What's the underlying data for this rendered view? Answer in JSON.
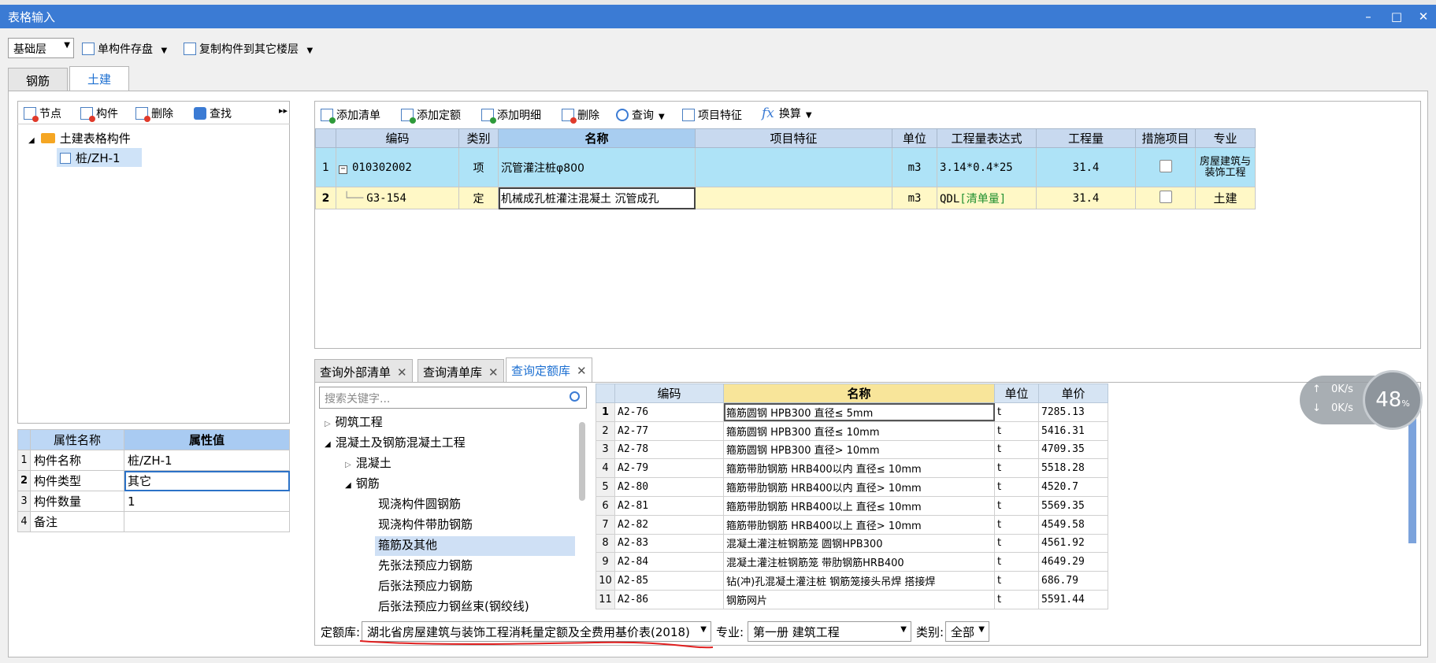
{
  "window": {
    "title": "表格输入"
  },
  "toolbar": {
    "floor_select": "基础层",
    "save_component": "单构件存盘",
    "copy_to_floor": "复制构件到其它楼层"
  },
  "main_tabs": [
    "钢筋",
    "土建"
  ],
  "left_toolbar": {
    "node": "节点",
    "component": "构件",
    "delete": "删除",
    "find": "查找"
  },
  "tree": {
    "root": "土建表格构件",
    "child": "桩/ZH-1"
  },
  "props": {
    "headers": [
      "属性名称",
      "属性值"
    ],
    "rows": [
      {
        "n": "1",
        "name": "构件名称",
        "value": "桩/ZH-1"
      },
      {
        "n": "2",
        "name": "构件类型",
        "value": "其它"
      },
      {
        "n": "3",
        "name": "构件数量",
        "value": "1"
      },
      {
        "n": "4",
        "name": "备注",
        "value": ""
      }
    ]
  },
  "grid_toolbar": {
    "add_list": "添加清单",
    "add_quota": "添加定额",
    "add_detail": "添加明细",
    "delete": "删除",
    "query": "查询",
    "feature": "项目特征",
    "convert": "换算"
  },
  "bill": {
    "headers": [
      "编码",
      "类别",
      "名称",
      "项目特征",
      "单位",
      "工程量表达式",
      "工程量",
      "措施项目",
      "专业"
    ],
    "rows": [
      {
        "n": "1",
        "code": "010302002",
        "type": "项",
        "name": "沉管灌注桩φ800",
        "feature": "",
        "unit": "m3",
        "expr": "3.14*0.4*25",
        "qty": "31.4",
        "major": "房屋建筑与装饰工程"
      },
      {
        "n": "2",
        "code": "G3-154",
        "type": "定",
        "name": "机械成孔桩灌注混凝土 沉管成孔",
        "feature": "",
        "unit": "m3",
        "expr_prefix": "QDL",
        "expr_tag": "[清单量]",
        "qty": "31.4",
        "major": "土建"
      }
    ]
  },
  "bottom_tabs": [
    "查询外部清单",
    "查询清单库",
    "查询定额库"
  ],
  "search": {
    "placeholder": "搜索关键字..."
  },
  "lib_tree": {
    "masonry": "砌筑工程",
    "concrete": "混凝土及钢筋混凝土工程",
    "concrete_sub": "混凝土",
    "rebar": "钢筋",
    "leaf1": "现浇构件圆钢筋",
    "leaf2": "现浇构件带肋钢筋",
    "leaf3": "箍筋及其他",
    "leaf4": "先张法预应力钢筋",
    "leaf5": "后张法预应力钢筋",
    "leaf6": "后张法预应力钢丝束(钢绞线)"
  },
  "quota": {
    "headers": [
      "编码",
      "名称",
      "单位",
      "单价"
    ],
    "rows": [
      {
        "n": "1",
        "code": "A2-76",
        "name": "箍筋圆钢 HPB300 直径≤ 5mm",
        "unit": "t",
        "price": "7285.13"
      },
      {
        "n": "2",
        "code": "A2-77",
        "name": "箍筋圆钢 HPB300 直径≤ 10mm",
        "unit": "t",
        "price": "5416.31"
      },
      {
        "n": "3",
        "code": "A2-78",
        "name": "箍筋圆钢 HPB300 直径> 10mm",
        "unit": "t",
        "price": "4709.35"
      },
      {
        "n": "4",
        "code": "A2-79",
        "name": "箍筋带肋钢筋 HRB400以内 直径≤ 10mm",
        "unit": "t",
        "price": "5518.28"
      },
      {
        "n": "5",
        "code": "A2-80",
        "name": "箍筋带肋钢筋 HRB400以内 直径> 10mm",
        "unit": "t",
        "price": "4520.7"
      },
      {
        "n": "6",
        "code": "A2-81",
        "name": "箍筋带肋钢筋 HRB400以上 直径≤ 10mm",
        "unit": "t",
        "price": "5569.35"
      },
      {
        "n": "7",
        "code": "A2-82",
        "name": "箍筋带肋钢筋 HRB400以上 直径> 10mm",
        "unit": "t",
        "price": "4549.58"
      },
      {
        "n": "8",
        "code": "A2-83",
        "name": "混凝土灌注桩钢筋笼 圆钢HPB300",
        "unit": "t",
        "price": "4561.92"
      },
      {
        "n": "9",
        "code": "A2-84",
        "name": "混凝土灌注桩钢筋笼 带肋钢筋HRB400",
        "unit": "t",
        "price": "4649.29"
      },
      {
        "n": "10",
        "code": "A2-85",
        "name": "钻(冲)孔混凝土灌注桩 钢筋笼接头吊焊 搭接焊",
        "unit": "t",
        "price": "686.79"
      },
      {
        "n": "11",
        "code": "A2-86",
        "name": "钢筋网片",
        "unit": "t",
        "price": "5591.44"
      }
    ]
  },
  "filter": {
    "lib_label": "定额库:",
    "lib_value": "湖北省房屋建筑与装饰工程消耗量定额及全费用基价表(2018)",
    "major_label": "专业:",
    "major_value": "第一册 建筑工程",
    "type_label": "类别:",
    "type_value": "全部"
  },
  "speed_widget": {
    "up": "0K/s",
    "down": "0K/s",
    "percent": "48"
  }
}
